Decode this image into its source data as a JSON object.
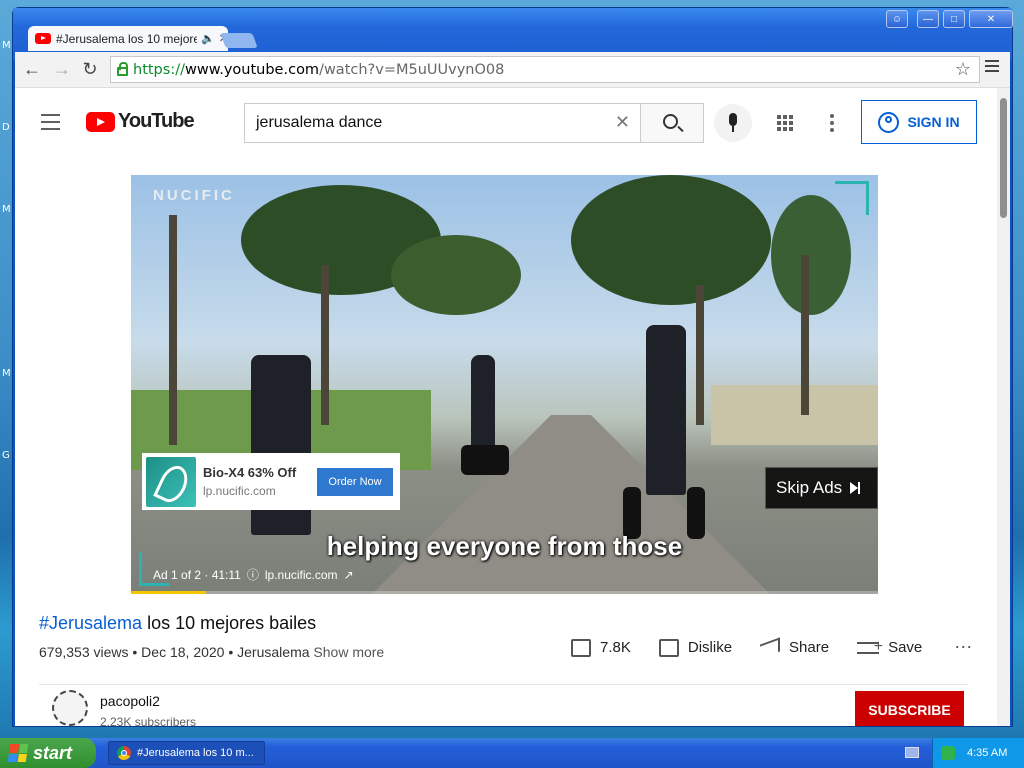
{
  "desktop": {
    "side_glyphs": [
      "M",
      "D",
      "M",
      "M",
      "G"
    ]
  },
  "browser": {
    "tab_title": "#Jerusalema los 10 mejores bailes",
    "url_scheme": "https://",
    "url_host": "www.youtube.com",
    "url_path": "/watch?v=M5uUUvynO08"
  },
  "youtube": {
    "logo_text": "YouTube",
    "search_value": "jerusalema dance",
    "sign_in_label": "SIGN IN",
    "video": {
      "watermark": "NUCIFIC",
      "caption": "helping everyone from those",
      "ad": {
        "title": "Bio-X4 63% Off",
        "url": "lp.nucific.com",
        "button": "Order Now"
      },
      "skip_label": "Skip Ads",
      "ad_info": {
        "counter": "Ad 1 of 2 · 41:11",
        "url": "lp.nucific.com"
      },
      "progress_fraction": 0.1
    },
    "title_hashtag": "#Jerusalema",
    "title_rest": " los 10 mejores bailes",
    "meta": "679,353 views • Dec 18, 2020 • Jerusalema",
    "show_more": "Show more",
    "actions": {
      "likes": "7.8K",
      "dislike": "Dislike",
      "share": "Share",
      "save": "Save"
    },
    "channel": {
      "name": "pacopoli2",
      "subscribers": "2.23K subscribers",
      "subscribe": "SUBSCRIBE"
    }
  },
  "taskbar": {
    "start": "start",
    "task_item": "#Jerusalema los 10 m...",
    "clock": "4:35 AM"
  }
}
